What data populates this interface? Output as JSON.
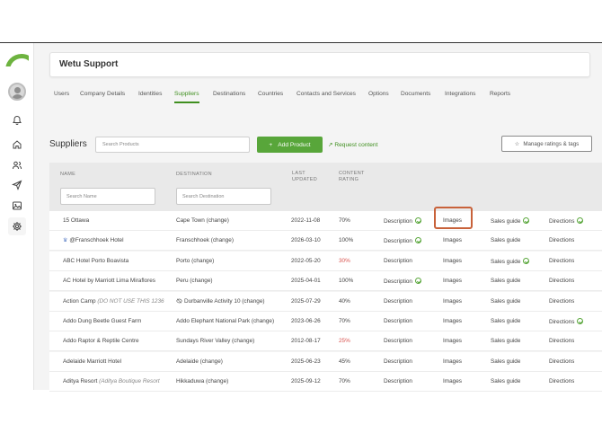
{
  "header": {
    "title": "Wetu Support"
  },
  "sidebar": {
    "icons": [
      "logo",
      "avatar",
      "bell-icon",
      "home-icon",
      "users-icon",
      "send-icon",
      "image-icon",
      "gear-icon"
    ],
    "accent": "#6db33f"
  },
  "tabs": [
    {
      "label": "Users"
    },
    {
      "label": "Company Details"
    },
    {
      "label": "Identities"
    },
    {
      "label": "Suppliers"
    },
    {
      "label": "Destinations"
    },
    {
      "label": "Countries"
    },
    {
      "label": "Contacts and Services"
    },
    {
      "label": "Options"
    },
    {
      "label": "Documents"
    },
    {
      "label": "Integrations"
    },
    {
      "label": "Reports"
    }
  ],
  "active_tab": "Suppliers",
  "toolbar": {
    "heading": "Suppliers",
    "search_placeholder": "Search Products",
    "add_label": "Add Product",
    "add_icon": "+",
    "request_label": "Request content",
    "request_icon": "↗",
    "manage_label": "Manage ratings & tags",
    "manage_icon": "☆"
  },
  "table": {
    "headers": {
      "name": "NAME",
      "destination": "DESTINATION",
      "updated": "LAST UPDATED",
      "updated_l1": "LAST",
      "updated_l2": "UPDATED",
      "rating": "CONTENT RATING",
      "rating_l1": "CONTENT",
      "rating_l2": "RATING"
    },
    "filters": {
      "name_placeholder": "Search Name",
      "destination_placeholder": "Search Destination"
    },
    "change_label": "(change)",
    "rows": [
      {
        "name": "15 Ottawa",
        "name_note": "",
        "prefix_icon": "",
        "destination": "Cape Town",
        "updated": "2022-11-08",
        "rating": "70%",
        "low": false,
        "desc_check": true,
        "images": "Images",
        "sales_check": true,
        "dir_check": true
      },
      {
        "name": "@Franschhoek Hotel",
        "name_note": "",
        "prefix_icon": "crown-icon",
        "destination": "Franschhoek",
        "updated": "2026-03-10",
        "rating": "100%",
        "low": false,
        "desc_check": true,
        "images": "Images",
        "sales_check": false,
        "dir_check": false
      },
      {
        "name": "ABC Hotel Porto Boavista",
        "name_note": "",
        "prefix_icon": "",
        "destination": "Porto",
        "updated": "2022-05-20",
        "rating": "30%",
        "low": true,
        "desc_check": false,
        "images": "Images",
        "sales_check": true,
        "dir_check": false
      },
      {
        "name": "AC Hotel by Marriott Lima Miraflores",
        "name_note": "",
        "prefix_icon": "",
        "destination": "Peru",
        "updated": "2025-04-01",
        "rating": "100%",
        "low": false,
        "desc_check": true,
        "images": "Images",
        "sales_check": false,
        "dir_check": false
      },
      {
        "name": "Action Camp",
        "name_note": "(DO NOT USE THIS 1236",
        "prefix_icon": "",
        "destination": "Durbanville Activity 10",
        "dest_icon": "eye-off-icon",
        "updated": "2025-07-29",
        "rating": "40%",
        "low": false,
        "desc_check": false,
        "images": "Images",
        "sales_check": false,
        "dir_check": false
      },
      {
        "name": "Addo Dung Beetle Guest Farm",
        "name_note": "",
        "prefix_icon": "",
        "destination": "Addo Elephant National Park",
        "updated": "2023-06-26",
        "rating": "70%",
        "low": false,
        "desc_check": false,
        "images": "Images",
        "sales_check": false,
        "dir_check": true
      },
      {
        "name": "Addo Raptor & Reptile Centre",
        "name_note": "",
        "prefix_icon": "",
        "destination": "Sundays River Valley",
        "updated": "2012-08-17",
        "rating": "25%",
        "low": true,
        "desc_check": false,
        "images": "Images",
        "sales_check": false,
        "dir_check": false
      },
      {
        "name": "Adelaide Marriott Hotel",
        "name_note": "",
        "prefix_icon": "",
        "destination": "Adelaide",
        "updated": "2025-06-23",
        "rating": "45%",
        "low": false,
        "desc_check": false,
        "images": "Images",
        "sales_check": false,
        "dir_check": false
      },
      {
        "name": "Aditya Resort",
        "name_note": "(Aditya Boutique Resort",
        "prefix_icon": "",
        "destination": "Hikkaduwa",
        "updated": "2025-09-12",
        "rating": "70%",
        "low": false,
        "desc_check": false,
        "images": "Images",
        "sales_check": false,
        "dir_check": false
      }
    ],
    "actions": {
      "description": "Description",
      "sales_guide": "Sales guide",
      "directions": "Directions"
    }
  },
  "colors": {
    "accent_green": "#58a63a",
    "warning_red": "#d9534f",
    "highlight": "#c8623a"
  }
}
